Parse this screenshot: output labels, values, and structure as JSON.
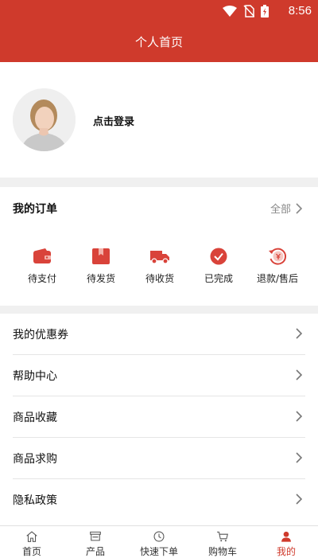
{
  "status_bar": {
    "time": "8:56"
  },
  "header": {
    "title": "个人首页"
  },
  "profile": {
    "login_label": "点击登录"
  },
  "orders": {
    "title": "我的订单",
    "all_label": "全部",
    "items": [
      {
        "label": "待支付",
        "icon": "wallet-icon"
      },
      {
        "label": "待发货",
        "icon": "box-icon"
      },
      {
        "label": "待收货",
        "icon": "truck-icon"
      },
      {
        "label": "已完成",
        "icon": "check-icon"
      },
      {
        "label": "退款/售后",
        "icon": "refund-icon"
      }
    ]
  },
  "menu": {
    "items": [
      {
        "label": "我的优惠券"
      },
      {
        "label": "帮助中心"
      },
      {
        "label": "商品收藏"
      },
      {
        "label": "商品求购"
      },
      {
        "label": "隐私政策"
      }
    ]
  },
  "tabbar": {
    "items": [
      {
        "label": "首页",
        "icon": "home-icon"
      },
      {
        "label": "产品",
        "icon": "store-icon"
      },
      {
        "label": "快速下单",
        "icon": "clock-icon"
      },
      {
        "label": "购物车",
        "icon": "cart-icon"
      },
      {
        "label": "我的",
        "icon": "user-icon",
        "active": true
      }
    ]
  },
  "colors": {
    "brand": "#cf3a2c",
    "order_icon": "#d9433a"
  }
}
